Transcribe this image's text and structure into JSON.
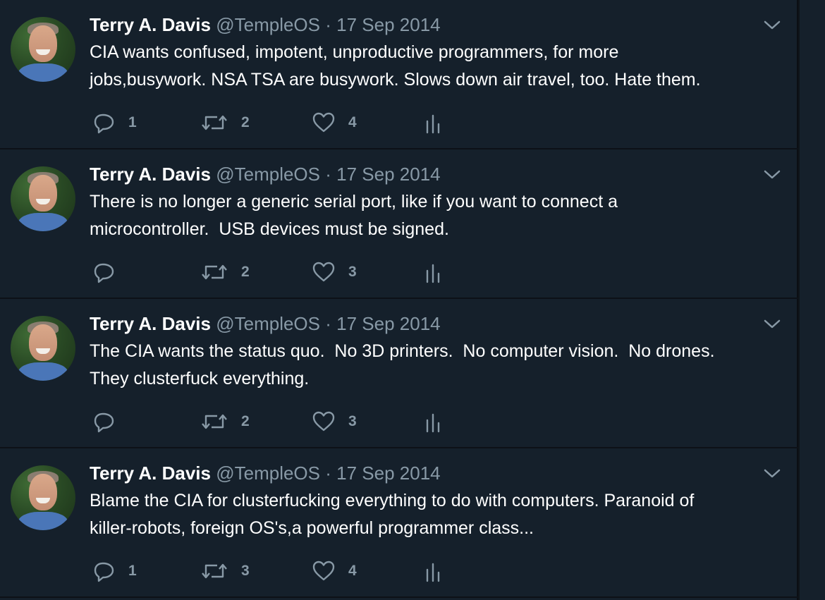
{
  "colors": {
    "background": "#15202b",
    "text": "#ffffff",
    "secondary": "#8899a6",
    "divider": "#0d1117"
  },
  "icons": {
    "reply": "speech-bubble-icon",
    "retweet": "retweet-arrows-icon",
    "like": "heart-icon",
    "stats": "bar-chart-icon",
    "menu": "chevron-down-icon"
  },
  "tweets": [
    {
      "author": "Terry A. Davis",
      "handle": "@TempleOS",
      "separator": "·",
      "date": "17 Sep 2014",
      "text": "CIA wants confused, impotent, unproductive programmers, for more\njobs,busywork. NSA TSA are busywork. Slows down air travel, too. Hate them.",
      "replies": "1",
      "retweets": "2",
      "likes": "4"
    },
    {
      "author": "Terry A. Davis",
      "handle": "@TempleOS",
      "separator": "·",
      "date": "17 Sep 2014",
      "text": "There is no longer a generic serial port, like if you want to connect a\nmicrocontroller.  USB devices must be signed.",
      "replies": "",
      "retweets": "2",
      "likes": "3"
    },
    {
      "author": "Terry A. Davis",
      "handle": "@TempleOS",
      "separator": "·",
      "date": "17 Sep 2014",
      "text": "The CIA wants the status quo.  No 3D printers.  No computer vision.  No drones.\nThey clusterfuck everything.",
      "replies": "",
      "retweets": "2",
      "likes": "3"
    },
    {
      "author": "Terry A. Davis",
      "handle": "@TempleOS",
      "separator": "·",
      "date": "17 Sep 2014",
      "text": "Blame the CIA for clusterfucking everything to do with computers. Paranoid of\nkiller-robots, foreign OS's,a powerful programmer class...",
      "replies": "1",
      "retweets": "3",
      "likes": "4"
    }
  ]
}
